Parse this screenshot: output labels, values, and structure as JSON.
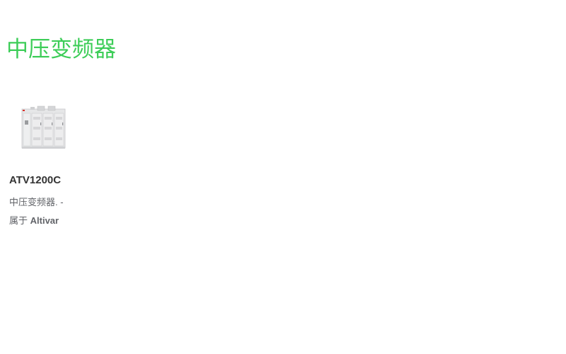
{
  "page": {
    "title": "中压变频器"
  },
  "product": {
    "name": "ATV1200C",
    "description": "中压变频器. -",
    "range_prefix": "属于",
    "range_name": "Altivar"
  },
  "colors": {
    "title": "#3dcd58",
    "name": "#333333",
    "text": "#626469"
  }
}
